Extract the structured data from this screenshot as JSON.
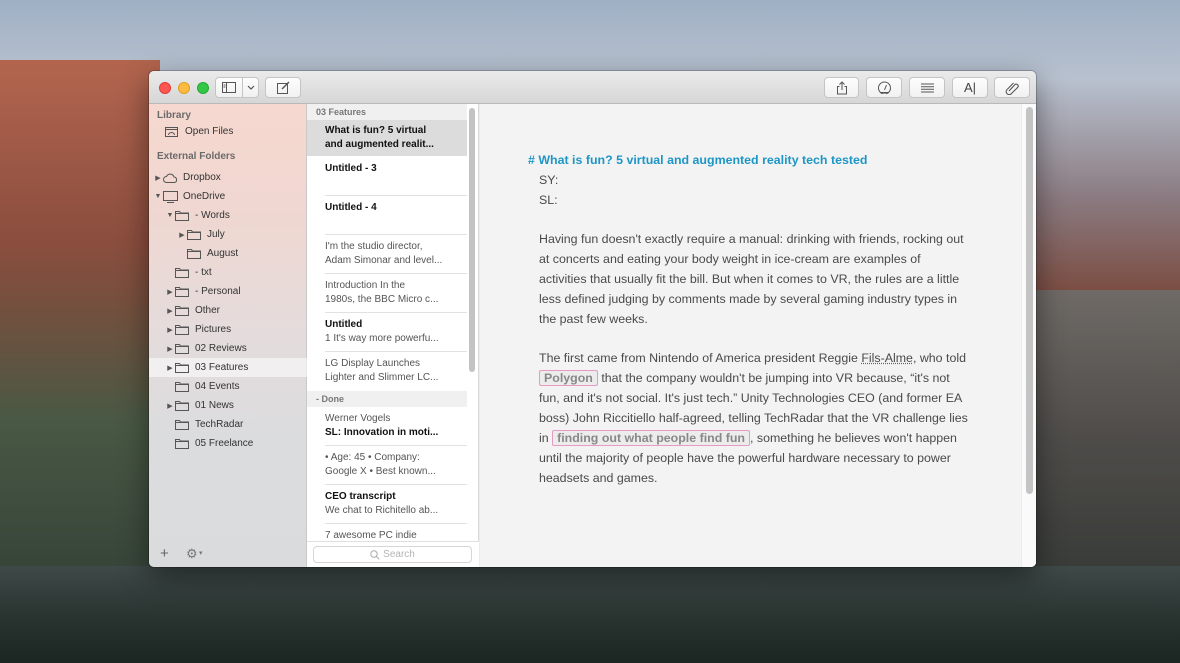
{
  "window": {
    "toolbar": {
      "left_buttons": [
        "sidebar-toggle",
        "sidebar-menu-chevron",
        "new-note"
      ],
      "right_buttons": [
        "share",
        "statistics-gauge",
        "table-of-contents",
        "markup-text",
        "attachments"
      ]
    }
  },
  "sidebar": {
    "library_heading": "Library",
    "library_items": [
      {
        "label": "Open Files",
        "icon": "open-files-icon"
      }
    ],
    "external_heading": "External Folders",
    "folders": [
      {
        "label": "Dropbox",
        "icon": "cloud-icon",
        "disclosure": "collapsed",
        "level": 0
      },
      {
        "label": "OneDrive",
        "icon": "monitor-icon",
        "disclosure": "expanded",
        "level": 0
      },
      {
        "label": "- Words",
        "icon": "folder-icon",
        "disclosure": "expanded",
        "level": 1
      },
      {
        "label": "July",
        "icon": "folder-icon",
        "disclosure": "collapsed",
        "level": 2
      },
      {
        "label": "August",
        "icon": "folder-icon",
        "disclosure": "none",
        "level": 2
      },
      {
        "label": "- txt",
        "icon": "folder-icon",
        "disclosure": "none",
        "level": 1
      },
      {
        "label": "- Personal",
        "icon": "folder-icon",
        "disclosure": "collapsed",
        "level": 1
      },
      {
        "label": "Other",
        "icon": "folder-icon",
        "disclosure": "collapsed",
        "level": 1
      },
      {
        "label": "Pictures",
        "icon": "folder-icon",
        "disclosure": "collapsed",
        "level": 1
      },
      {
        "label": "02 Reviews",
        "icon": "folder-icon",
        "disclosure": "collapsed",
        "level": 1
      },
      {
        "label": "03 Features",
        "icon": "folder-icon",
        "disclosure": "collapsed",
        "level": 1,
        "selected": true
      },
      {
        "label": "04 Events",
        "icon": "folder-icon",
        "disclosure": "none",
        "level": 1
      },
      {
        "label": "01 News",
        "icon": "folder-icon",
        "disclosure": "collapsed",
        "level": 1
      },
      {
        "label": "TechRadar",
        "icon": "folder-icon",
        "disclosure": "none",
        "level": 1
      },
      {
        "label": "05 Freelance",
        "icon": "folder-icon",
        "disclosure": "none",
        "level": 1
      }
    ],
    "add_label": "+",
    "gear_label": "⚙"
  },
  "notelist": {
    "group1": "03 Features",
    "items1": [
      {
        "title": "What is fun? 5 virtual",
        "title2": "and augmented realit...",
        "selected": true
      },
      {
        "title": "Untitled - 3",
        "sub": ""
      },
      {
        "title": "Untitled - 4",
        "sub": ""
      },
      {
        "title": "",
        "sub": "I'm the studio director,",
        "sub2": "Adam Simonar and level..."
      },
      {
        "title": "",
        "sub": "Introduction In the",
        "sub2": "1980s, the BBC Micro c..."
      },
      {
        "title": "Untitled",
        "sub": "1 It's way more powerfu..."
      },
      {
        "title": "",
        "sub": "LG Display Launches",
        "sub2": "Lighter and Slimmer LC..."
      }
    ],
    "group2": "- Done",
    "items2": [
      {
        "sub": "Werner Vogels",
        "title": "SL: Innovation in moti..."
      },
      {
        "sub": "• Age: 45 • Company:",
        "sub2": "Google X • Best known..."
      },
      {
        "title": "CEO transcript",
        "sub": "We chat to Richitello ab..."
      },
      {
        "sub": "7 awesome PC indie"
      }
    ],
    "search_placeholder": "Search"
  },
  "editor": {
    "heading": "# What is fun? 5 virtual and augmented reality tech tested",
    "sy": "SY:",
    "sl": "SL:",
    "para1": "Having fun doesn't exactly require a manual: drinking with friends, rocking out at concerts and eating your body weight in ice-cream are examples of activities that usually fit the bill. But when it comes to VR, the rules are a little less defined judging by comments made by several gaming industry types in the past few weeks.",
    "para2_a": "The first came from Nintendo of America president Reggie ",
    "para2_spell": "Fils-Alme",
    "para2_b": ", who told ",
    "link1": "Polygon",
    "para2_c": " that the company wouldn't be jumping into VR because, “it's not fun, and it's not social. It's just tech.” Unity Technologies CEO (and former EA boss) John Riccitiello half-agreed, telling TechRadar that the VR challenge lies in ",
    "link2": "finding out what people find fun",
    "para2_d": ", something he believes won't happen until the majority of people have the powerful hardware necessary to power headsets and games."
  },
  "colors": {
    "heading": "#1d96c7",
    "link_border": "#e49bc4",
    "close": "#fc5753",
    "minimize": "#fdbc40",
    "maximize": "#33c748"
  }
}
